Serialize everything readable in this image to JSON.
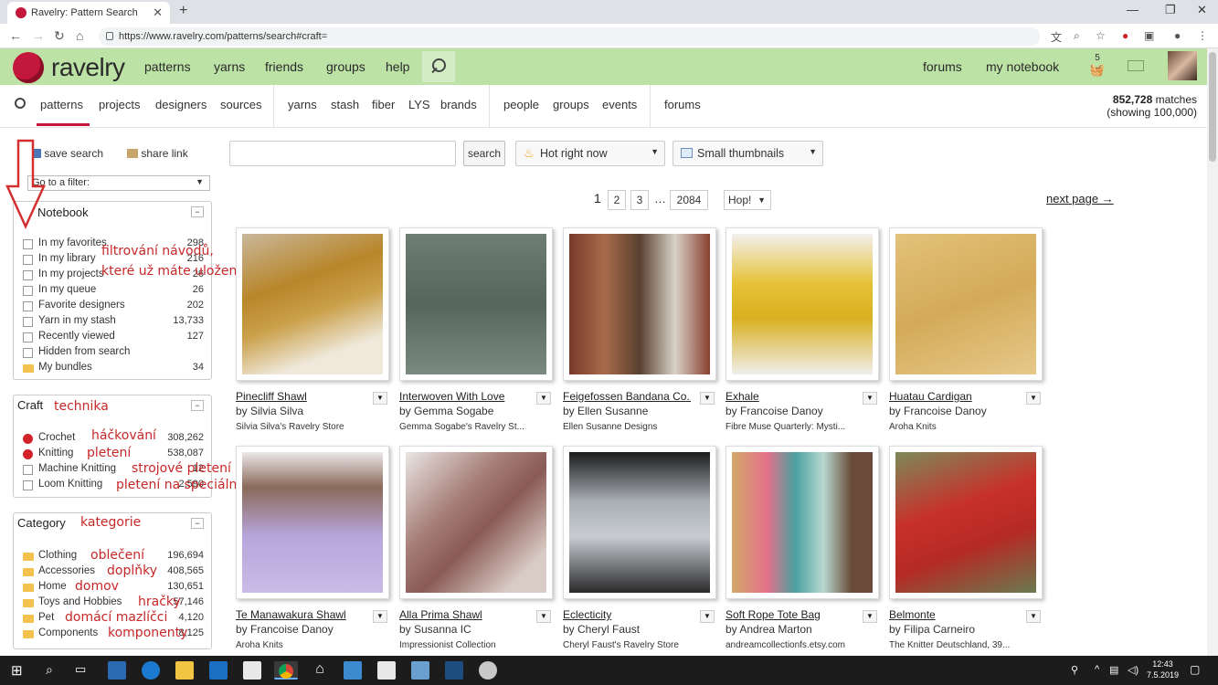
{
  "browser": {
    "tab_title": "Ravelry: Pattern Search",
    "url": "https://www.ravelry.com/patterns/search#craft="
  },
  "header": {
    "logo_text": "ravelry",
    "nav": [
      "patterns",
      "yarns",
      "friends",
      "groups",
      "help"
    ],
    "forums": "forums",
    "notebook": "my notebook",
    "cart_count": "5"
  },
  "subnav": {
    "items": [
      "patterns",
      "projects",
      "designers",
      "sources",
      "yarns",
      "stash",
      "fiber",
      "LYS",
      "brands",
      "people",
      "groups",
      "events",
      "forums"
    ],
    "matches_count": "852,728",
    "matches_label": "matches",
    "showing": "(showing 100,000)"
  },
  "sidebar": {
    "save_search": "save search",
    "share_link": "share link",
    "filter_select": "Go to a filter:",
    "notebook": {
      "title": "Notebook",
      "items": [
        {
          "label": "In my favorites",
          "count": "298"
        },
        {
          "label": "In my library",
          "count": "216"
        },
        {
          "label": "In my projects",
          "count": "26"
        },
        {
          "label": "In my queue",
          "count": "26"
        },
        {
          "label": "Favorite designers",
          "count": "202"
        },
        {
          "label": "Yarn in my stash",
          "count": "13,733"
        },
        {
          "label": "Recently viewed",
          "count": "127"
        },
        {
          "label": "Hidden from search",
          "count": ""
        },
        {
          "label": "My bundles",
          "count": "34"
        }
      ]
    },
    "craft": {
      "title": "Craft",
      "items": [
        {
          "label": "Crochet",
          "count": "308,262"
        },
        {
          "label": "Knitting",
          "count": "538,087"
        },
        {
          "label": "Machine Knitting",
          "count": "12"
        },
        {
          "label": "Loom Knitting",
          "count": "2,590"
        }
      ]
    },
    "category": {
      "title": "Category",
      "items": [
        {
          "label": "Clothing",
          "count": "196,694"
        },
        {
          "label": "Accessories",
          "count": "408,565"
        },
        {
          "label": "Home",
          "count": "130,651"
        },
        {
          "label": "Toys and Hobbies",
          "count": "57,146"
        },
        {
          "label": "Pet",
          "count": "4,120"
        },
        {
          "label": "Components",
          "count": "8,125"
        }
      ]
    }
  },
  "annotations": {
    "filter_note_1": "filtrování návodů,",
    "filter_note_2": "které už máte uložené",
    "technika": "technika",
    "hackovani": "háčkování",
    "pleteni": "pletení",
    "strojove": "strojové pletení",
    "stavek": "pletení na speciálním stávku",
    "kategorie": "kategorie",
    "obleceni": "oblečení",
    "doplnky": "doplňky",
    "domov": "domov",
    "hracky": "hračky",
    "mazlicci": "domácí mazlíčci",
    "komponenty": "komponenty"
  },
  "toolbar": {
    "search_button": "search",
    "sort": "Hot right now",
    "view": "Small thumbnails"
  },
  "pagination": {
    "current": "1",
    "pages": [
      "2",
      "3"
    ],
    "ellipsis": "…",
    "last": "2084",
    "hop": "Hop!",
    "next": "next page →"
  },
  "patterns": [
    {
      "title": "Pinecliff Shawl",
      "by": "by Silvia Silva",
      "source": "Silvia Silva's Ravelry Store"
    },
    {
      "title": "Interwoven With Love",
      "by": "by Gemma Sogabe",
      "source": "Gemma Sogabe's Ravelry St..."
    },
    {
      "title": "Feigefossen Bandana Co...",
      "by": "by Ellen Susanne",
      "source": "Ellen Susanne Designs"
    },
    {
      "title": "Exhale",
      "by": "by Francoise Danoy",
      "source": "Fibre Muse Quarterly: Mysti..."
    },
    {
      "title": "Huatau Cardigan",
      "by": "by Francoise Danoy",
      "source": "Aroha Knits"
    },
    {
      "title": "Te Manawakura Shawl",
      "by": "by Francoise Danoy",
      "source": "Aroha Knits"
    },
    {
      "title": "Alla Prima Shawl",
      "by": "by Susanna IC",
      "source": "Impressionist Collection"
    },
    {
      "title": "Eclecticity",
      "by": "by Cheryl Faust",
      "source": "Cheryl Faust's Ravelry Store"
    },
    {
      "title": "Soft Rope Tote Bag",
      "by": "by Andrea Marton",
      "source": "andreamcollectionfs.etsy.com"
    },
    {
      "title": "Belmonte",
      "by": "by Filipa Carneiro",
      "source": "The Knitter Deutschland, 39..."
    }
  ],
  "taskbar": {
    "time": "12:43",
    "date": "7.5.2019"
  }
}
